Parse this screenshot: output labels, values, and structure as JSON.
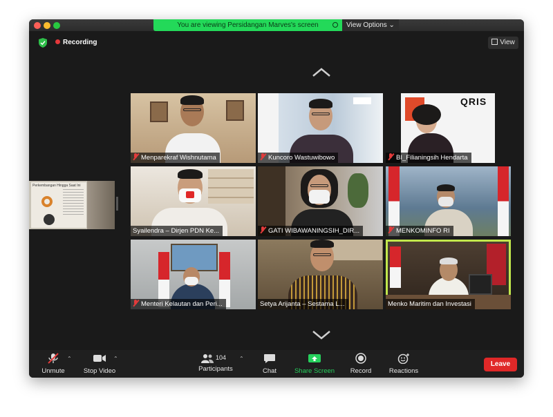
{
  "banner": {
    "share_text": "You are viewing Persidangan Marves's screen",
    "view_options": "View Options ⌄"
  },
  "status": {
    "recording": "Recording",
    "view": "View"
  },
  "shared_screen": {
    "title": "Perkembangan\nHingga Saat Ini"
  },
  "participants": [
    {
      "name": "Menparekraf Wishnutama",
      "muted": true
    },
    {
      "name": "Kuncoro Wastuwibowo",
      "muted": true
    },
    {
      "name": "BI_Filianingsih Hendarta",
      "muted": true
    },
    {
      "name": "Syailendra – Dirjen PDN Ke...",
      "muted": false
    },
    {
      "name": "GATI WIBAWANINGSIH_DIR...",
      "muted": true
    },
    {
      "name": "MENKOMINFO RI",
      "muted": true
    },
    {
      "name": "Menteri Kelautan dan Peri...",
      "muted": true
    },
    {
      "name": "Setya Arijanta – Sestama L...",
      "muted": false
    },
    {
      "name": "Menko Maritim dan Investasi",
      "muted": false,
      "active_speaker": true
    }
  ],
  "toolbar": {
    "unmute": "Unmute",
    "stop_video": "Stop Video",
    "participants": "Participants",
    "participants_count": "104",
    "chat": "Chat",
    "share_screen": "Share Screen",
    "record": "Record",
    "reactions": "Reactions",
    "leave": "Leave"
  },
  "colors": {
    "share_banner": "#23d959",
    "active_speaker_border": "#c2e84c",
    "leave_button": "#e02828",
    "share_screen_icon": "#26d15d"
  }
}
